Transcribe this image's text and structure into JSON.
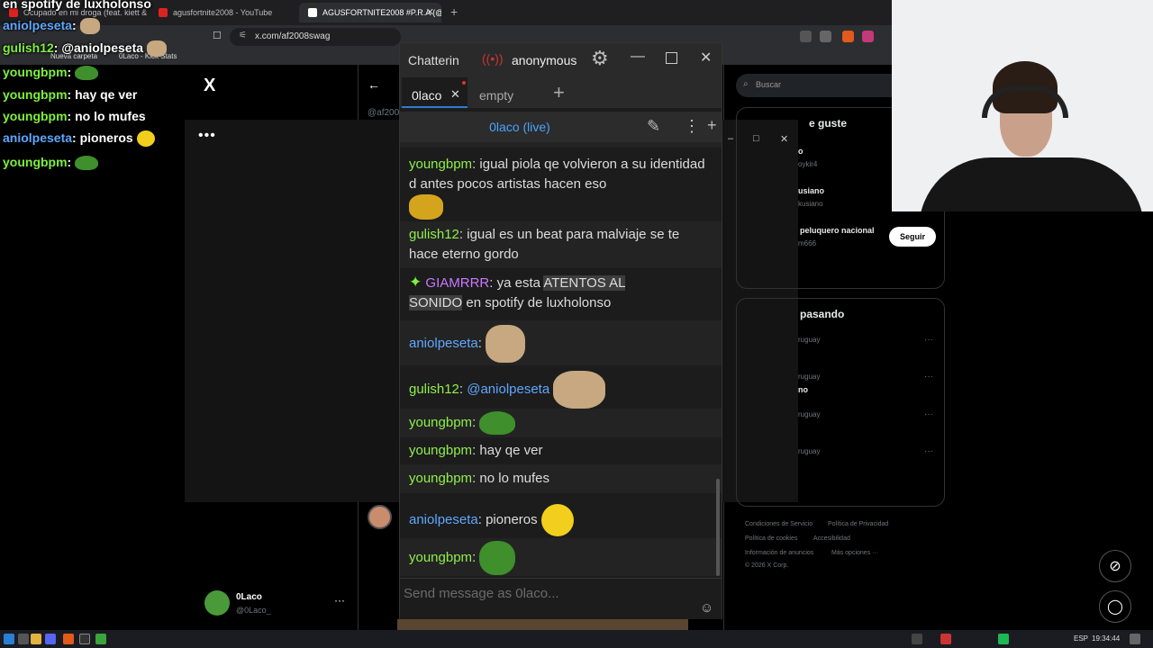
{
  "browser": {
    "tabs": [
      {
        "title": "Ocupado en mi droga (feat. kiett &",
        "color": "#d22"
      },
      {
        "title": "agusfortnite2008 - YouTube",
        "color": "#d22"
      },
      {
        "title": "AGUSFORTNITE2008 #P.R.A (@a",
        "color": "#fff"
      }
    ],
    "address": "x.com/af2008swag",
    "bookmarks": [
      "Nueva carpeta",
      "0Laco - Kick Stats"
    ]
  },
  "overlay": {
    "top_text": "en spotify de luxholonso",
    "lines": [
      {
        "user": "aniolpeseta",
        "text": "",
        "color": "blue",
        "emote": "cat"
      },
      {
        "user": "gulish12",
        "text": "@aniolpeseta",
        "color": "green",
        "emote": "cat"
      },
      {
        "user": "youngbpm",
        "text": "",
        "color": "green",
        "emote": "pepe"
      },
      {
        "user": "youngbpm",
        "text": "hay qe ver",
        "color": "green",
        "emote": ""
      },
      {
        "user": "youngbpm",
        "text": "no lo mufes",
        "color": "green",
        "emote": ""
      },
      {
        "user": "aniolpeseta",
        "text": "pioneros",
        "color": "blue",
        "emote": "smile"
      },
      {
        "user": "youngbpm",
        "text": "",
        "color": "green",
        "emote": "pepe"
      }
    ]
  },
  "xpage": {
    "handle": "@af200",
    "search_placeholder": "Buscar",
    "suggest_title": "e guste",
    "suggestions": [
      {
        "name": "o",
        "handle": "oykir4"
      },
      {
        "name": "usiano",
        "handle": "kusiano"
      },
      {
        "name": "peluquero nacional",
        "handle": "m666"
      }
    ],
    "follow_label": "Seguir",
    "trending_title": "pasando",
    "trends": [
      "ruguay",
      "ruguay",
      "no",
      "ruguay",
      "ruguay"
    ],
    "footer": [
      "Condiciones de Servicio",
      "Política de Privacidad",
      "Política de cookies",
      "Accesibilidad",
      "Información de anuncios",
      "Más opciones ···",
      "© 2026 X Corp."
    ],
    "account": {
      "name": "0Laco",
      "handle": "@0Laco_"
    }
  },
  "chatterino": {
    "brand": "Chatterin",
    "user": "anonymous",
    "tabs": [
      {
        "label": "0laco"
      },
      {
        "label": "empty"
      }
    ],
    "channel": "0laco (live)",
    "input_placeholder": "Send message as 0laco...",
    "messages": [
      {
        "user": "youngbpm",
        "sep": ": ",
        "text": "igual piola qe volvieron a su identidad d antes pocos artistas hacen eso"
      },
      {
        "user": "gulish12",
        "sep": ": ",
        "text": "igual es un beat para malviaje se te hace eterno gordo"
      },
      {
        "user": "GIAMRRR",
        "sep": ": ",
        "text_a": "ya esta ",
        "text_hl1": "ATENTOS AL",
        "text_hl2": "SONIDO",
        "text_b": " en spotify de luxholonso"
      },
      {
        "user": "aniolpeseta",
        "sep": ":",
        "text": ""
      },
      {
        "user": "gulish12",
        "sep": ": ",
        "text": "@aniolpeseta"
      },
      {
        "user": "youngbpm",
        "sep": ":",
        "text": ""
      },
      {
        "user": "youngbpm",
        "sep": ": ",
        "text": "hay qe ver"
      },
      {
        "user": "youngbpm",
        "sep": ": ",
        "text": "no lo mufes"
      },
      {
        "user": "aniolpeseta",
        "sep": ": ",
        "text": "pioneros"
      },
      {
        "user": "youngbpm",
        "sep": ":",
        "text": ""
      }
    ]
  },
  "taskbar": {
    "lang": "ESP",
    "time": "19:34:44"
  },
  "colors": {
    "chat_green": "#8ff04a",
    "chat_blue": "#5ea7ff",
    "chat_purple": "#c879ff",
    "link_blue": "#4aa3ff"
  }
}
